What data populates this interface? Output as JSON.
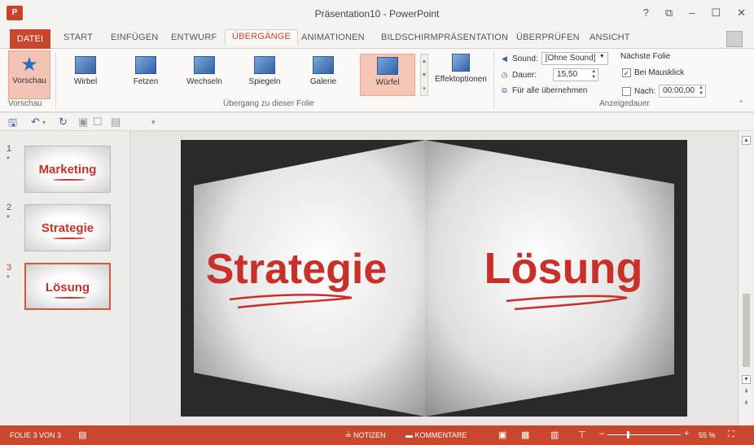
{
  "window": {
    "title": "Präsentation10 - PowerPoint",
    "app_icon": "P",
    "controls": [
      "?",
      "⧉",
      "–",
      "☐",
      "✕"
    ]
  },
  "tabs": {
    "file": "DATEI",
    "items": [
      "START",
      "EINFÜGEN",
      "ENTWURF",
      "ÜBERGÄNGE",
      "ANIMATIONEN",
      "BILDSCHIRMPRÄSENTATION",
      "ÜBERPRÜFEN",
      "ANSICHT"
    ],
    "active": "ÜBERGÄNGE"
  },
  "ribbon": {
    "preview_label": "Vorschau",
    "preview_group": "Vorschau",
    "transitions": [
      {
        "label": "Wirbel",
        "icon": "wirbel-icon"
      },
      {
        "label": "Fetzen",
        "icon": "fetzen-icon"
      },
      {
        "label": "Wechseln",
        "icon": "wechseln-icon"
      },
      {
        "label": "Spiegeln",
        "icon": "spiegeln-icon"
      },
      {
        "label": "Galerie",
        "icon": "galerie-icon"
      },
      {
        "label": "Würfel",
        "icon": "wuerfel-icon"
      }
    ],
    "selected_transition": "Würfel",
    "effect_options_label": "Effektoptionen",
    "transition_group_label": "Übergang zu dieser Folie",
    "sound_label": "Sound:",
    "sound_value": "[Ohne Sound]",
    "duration_label": "Dauer:",
    "duration_value": "15,50",
    "apply_all_label": "Für alle übernehmen",
    "next_slide_label": "Nächste Folie",
    "on_click_label": "Bei Mausklick",
    "on_click_checked": true,
    "after_label": "Nach:",
    "after_value": "00:00,00",
    "after_checked": false,
    "timing_group_label": "Anzeigedauer"
  },
  "slides": [
    {
      "number": "1",
      "star": "*",
      "title": "Marketing"
    },
    {
      "number": "2",
      "star": "*",
      "title": "Strategie"
    },
    {
      "number": "3",
      "star": "*",
      "title": "Lösung"
    }
  ],
  "active_slide": 3,
  "slide_canvas": {
    "left_face_text": "Strategie",
    "right_face_text": "Lösung"
  },
  "status": {
    "slide_info": "FOLIE 3 VON 3",
    "notes_label": "NOTIZEN",
    "comments_label": "KOMMENTARE",
    "zoom": "55 %",
    "zoom_level": 55
  },
  "colors": {
    "accent": "#c8472d",
    "slide_text": "#c8312a"
  }
}
